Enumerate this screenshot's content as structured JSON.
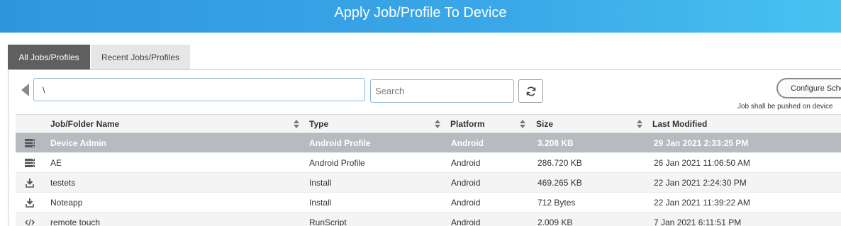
{
  "header": {
    "title": "Apply Job/Profile To Device"
  },
  "tabs": [
    {
      "label": "All Jobs/Profiles",
      "active": true
    },
    {
      "label": "Recent Jobs/Profiles",
      "active": false
    }
  ],
  "toolbar": {
    "path_value": "\\",
    "search_placeholder": "Search",
    "configure_label": "Configure Schedule",
    "push_note": "Job shall be pushed on device"
  },
  "table": {
    "columns": [
      "Job/Folder Name",
      "Type",
      "Platform",
      "Size",
      "Last Modified"
    ],
    "rows": [
      {
        "icon": "profile-icon",
        "name": "Device Admin",
        "type": "Android Profile",
        "platform": "Android",
        "size": "3.208 KB",
        "modified": "29 Jan 2021 2:33:25 PM"
      },
      {
        "icon": "profile-icon",
        "name": "AE",
        "type": "Android Profile",
        "platform": "Android",
        "size": "286.720 KB",
        "modified": "26 Jan 2021 11:06:50 AM"
      },
      {
        "icon": "install-icon",
        "name": "testets",
        "type": "Install",
        "platform": "Android",
        "size": "469.265 KB",
        "modified": "22 Jan 2021 2:24:30 PM"
      },
      {
        "icon": "install-icon",
        "name": "Noteapp",
        "type": "Install",
        "platform": "Android",
        "size": "712 Bytes",
        "modified": "22 Jan 2021 11:39:22 AM"
      },
      {
        "icon": "code-icon",
        "name": "remote touch",
        "type": "RunScript",
        "platform": "Android",
        "size": "2.009 KB",
        "modified": "7 Jan 2021 6:11:51 PM"
      }
    ]
  },
  "colors": {
    "header_start": "#2f96de",
    "header_end": "#48c2f0",
    "selected_row": "#b7babe",
    "active_tab": "#5f5f5f"
  }
}
